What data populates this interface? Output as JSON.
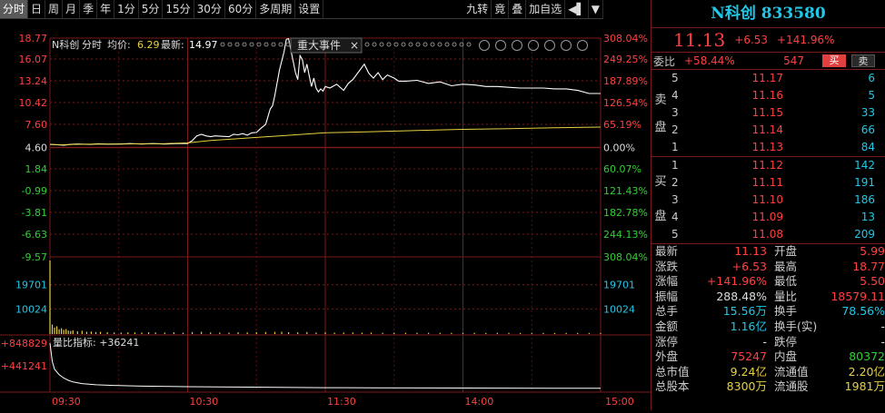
{
  "toolbar": {
    "items": [
      "分时",
      "日",
      "周",
      "月",
      "季",
      "年",
      "1分",
      "5分",
      "15分",
      "30分",
      "60分",
      "多周期",
      "设置"
    ],
    "right": [
      "九转",
      "竟",
      "叠",
      "加自选",
      "◀▌",
      "▼"
    ]
  },
  "chart_header": {
    "name": "N科创",
    "mode": "分时",
    "avg_label": "均价:",
    "avg_value": "6.29",
    "last_label": "最新:",
    "last_value": "14.97",
    "event_button": "重大事件",
    "close_symbol": "×"
  },
  "chart_data": {
    "type": "line",
    "title": "",
    "prev_close": 4.6,
    "ylim": [
      -9.57,
      18.77
    ],
    "price_ticks": [
      "18.77",
      "16.07",
      "13.24",
      "10.42",
      "7.60",
      "4.60",
      "1.84",
      "-0.99",
      "-3.81",
      "-6.63",
      "-9.57"
    ],
    "price_tick_values": [
      18.77,
      16.07,
      13.24,
      10.42,
      7.6,
      4.6,
      1.84,
      -0.99,
      -3.81,
      -6.63,
      -9.57
    ],
    "pct_ticks": [
      "308.04%",
      "249.25%",
      "187.89%",
      "126.54%",
      "65.19%",
      "0.00%",
      "60.07%",
      "121.43%",
      "182.78%",
      "244.13%",
      "308.04%"
    ],
    "volume_ticks": [
      "19701",
      "10024"
    ],
    "volume_max": 29400,
    "indicator_label": "量比指标: +36241",
    "indicator_ticks": [
      "+848829",
      "+441241"
    ],
    "time_labels": [
      "09:30",
      "10:30",
      "11:30",
      "14:00",
      "15:00"
    ],
    "price_series": [
      [
        0,
        5.0
      ],
      [
        3,
        4.95
      ],
      [
        6,
        4.9
      ],
      [
        9,
        5.0
      ],
      [
        12,
        5.05
      ],
      [
        15,
        5.02
      ],
      [
        18,
        5.0
      ],
      [
        21,
        5.08
      ],
      [
        25,
        5.03
      ],
      [
        30,
        5.05
      ],
      [
        35,
        5.1
      ],
      [
        40,
        5.05
      ],
      [
        45,
        5.1
      ],
      [
        50,
        5.05
      ],
      [
        55,
        5.1
      ],
      [
        60,
        5.12
      ],
      [
        62,
        5.5
      ],
      [
        64,
        6.1
      ],
      [
        66,
        6.3
      ],
      [
        68,
        6.1
      ],
      [
        70,
        6.0
      ],
      [
        72,
        6.1
      ],
      [
        75,
        6.05
      ],
      [
        78,
        6.0
      ],
      [
        80,
        6.3
      ],
      [
        82,
        6.25
      ],
      [
        84,
        6.4
      ],
      [
        86,
        6.2
      ],
      [
        88,
        6.5
      ],
      [
        90,
        6.55
      ],
      [
        92,
        7.1
      ],
      [
        94,
        7.6
      ],
      [
        96,
        9.6
      ],
      [
        97,
        10.0
      ],
      [
        98,
        11.3
      ],
      [
        100,
        14.6
      ],
      [
        102,
        17.0
      ],
      [
        103,
        18.6
      ],
      [
        104,
        18.7
      ],
      [
        105,
        17.2
      ],
      [
        106,
        15.8
      ],
      [
        107,
        14.3
      ],
      [
        108,
        13.4
      ],
      [
        109,
        16.5
      ],
      [
        110,
        16.0
      ],
      [
        111,
        14.3
      ],
      [
        112,
        15.4
      ],
      [
        113,
        13.9
      ],
      [
        114,
        12.5
      ],
      [
        115,
        13.6
      ],
      [
        116,
        12.3
      ],
      [
        117,
        11.8
      ],
      [
        118,
        12.2
      ],
      [
        119,
        11.9
      ],
      [
        120,
        12.5
      ],
      [
        122,
        12.3
      ],
      [
        125,
        12.8
      ],
      [
        128,
        12.0
      ],
      [
        130,
        12.9
      ],
      [
        132,
        13.4
      ],
      [
        135,
        14.6
      ],
      [
        137,
        15.4
      ],
      [
        139,
        14.2
      ],
      [
        141,
        13.6
      ],
      [
        143,
        14.3
      ],
      [
        145,
        13.4
      ],
      [
        147,
        14.0
      ],
      [
        150,
        13.6
      ],
      [
        152,
        13.2
      ],
      [
        155,
        13.2
      ],
      [
        160,
        13.3
      ],
      [
        165,
        12.9
      ],
      [
        170,
        13.1
      ],
      [
        175,
        12.6
      ],
      [
        180,
        12.8
      ],
      [
        185,
        12.7
      ],
      [
        190,
        12.5
      ],
      [
        195,
        12.5
      ],
      [
        200,
        12.4
      ],
      [
        205,
        12.3
      ],
      [
        210,
        12.3
      ],
      [
        215,
        12.3
      ],
      [
        220,
        12.2
      ],
      [
        225,
        12.2
      ],
      [
        230,
        12.0
      ],
      [
        235,
        11.6
      ],
      [
        240,
        11.6
      ]
    ],
    "avg_series": [
      [
        0,
        5.0
      ],
      [
        5,
        4.95
      ],
      [
        10,
        5.0
      ],
      [
        20,
        5.05
      ],
      [
        30,
        5.05
      ],
      [
        40,
        5.08
      ],
      [
        50,
        5.1
      ],
      [
        60,
        5.2
      ],
      [
        70,
        5.5
      ],
      [
        80,
        5.7
      ],
      [
        90,
        5.9
      ],
      [
        100,
        6.1
      ],
      [
        110,
        6.3
      ],
      [
        120,
        6.5
      ],
      [
        140,
        6.65
      ],
      [
        160,
        6.8
      ],
      [
        180,
        6.95
      ],
      [
        200,
        7.05
      ],
      [
        220,
        7.15
      ],
      [
        240,
        7.25
      ]
    ],
    "volume_series": [
      [
        0,
        29400
      ],
      [
        1,
        3800
      ],
      [
        2,
        2600
      ],
      [
        3,
        3100
      ],
      [
        4,
        1900
      ],
      [
        5,
        2300
      ],
      [
        6,
        1700
      ],
      [
        7,
        2000
      ],
      [
        8,
        1400
      ],
      [
        9,
        1200
      ],
      [
        10,
        1500
      ],
      [
        12,
        1100
      ],
      [
        14,
        1300
      ],
      [
        16,
        900
      ],
      [
        18,
        1000
      ],
      [
        20,
        800
      ],
      [
        22,
        900
      ],
      [
        25,
        700
      ],
      [
        28,
        650
      ],
      [
        31,
        600
      ],
      [
        34,
        700
      ],
      [
        37,
        650
      ],
      [
        40,
        600
      ],
      [
        43,
        700
      ],
      [
        46,
        650
      ],
      [
        50,
        600
      ],
      [
        54,
        700
      ],
      [
        58,
        550
      ],
      [
        62,
        800
      ],
      [
        66,
        900
      ],
      [
        70,
        650
      ],
      [
        74,
        600
      ],
      [
        78,
        550
      ],
      [
        82,
        700
      ],
      [
        86,
        650
      ],
      [
        90,
        750
      ],
      [
        94,
        800
      ],
      [
        98,
        850
      ],
      [
        101,
        900
      ],
      [
        104,
        750
      ],
      [
        108,
        700
      ],
      [
        112,
        800
      ],
      [
        116,
        600
      ],
      [
        120,
        650
      ],
      [
        124,
        550
      ],
      [
        128,
        600
      ],
      [
        132,
        650
      ],
      [
        136,
        550
      ],
      [
        140,
        600
      ],
      [
        145,
        500
      ],
      [
        150,
        550
      ],
      [
        155,
        500
      ],
      [
        160,
        520
      ],
      [
        165,
        480
      ],
      [
        170,
        500
      ],
      [
        175,
        480
      ],
      [
        180,
        460
      ],
      [
        185,
        500
      ],
      [
        190,
        450
      ],
      [
        195,
        480
      ],
      [
        200,
        460
      ],
      [
        205,
        440
      ],
      [
        210,
        470
      ],
      [
        215,
        450
      ],
      [
        220,
        430
      ],
      [
        225,
        460
      ],
      [
        230,
        440
      ],
      [
        235,
        420
      ],
      [
        240,
        450
      ]
    ],
    "indicator_series": [
      [
        0,
        848829
      ],
      [
        1,
        520000
      ],
      [
        2,
        380000
      ],
      [
        4,
        280000
      ],
      [
        6,
        220000
      ],
      [
        8,
        180000
      ],
      [
        10,
        150000
      ],
      [
        14,
        120000
      ],
      [
        20,
        100000
      ],
      [
        30,
        85000
      ],
      [
        40,
        75000
      ],
      [
        60,
        65000
      ],
      [
        80,
        58000
      ],
      [
        100,
        52000
      ],
      [
        120,
        48000
      ],
      [
        140,
        45000
      ],
      [
        160,
        42000
      ],
      [
        180,
        40000
      ],
      [
        200,
        38500
      ],
      [
        220,
        37000
      ],
      [
        240,
        36241
      ]
    ],
    "indicator_max": 880000,
    "grid": true
  },
  "quote": {
    "title": "N科创  833580",
    "price": "11.13",
    "change": "+6.53",
    "change_pct": "+141.96%",
    "weibi_label": "委比",
    "weibi_pct": "+58.44%",
    "weibi_diff": "547",
    "buy_btn": "买",
    "sell_btn": "卖",
    "sell_side_label": [
      "卖",
      "盘"
    ],
    "buy_side_label": [
      "买",
      "盘"
    ],
    "asks": [
      {
        "lvl": "5",
        "price": "11.17",
        "vol": "6"
      },
      {
        "lvl": "4",
        "price": "11.16",
        "vol": "5"
      },
      {
        "lvl": "3",
        "price": "11.15",
        "vol": "33"
      },
      {
        "lvl": "2",
        "price": "11.14",
        "vol": "66"
      },
      {
        "lvl": "1",
        "price": "11.13",
        "vol": "84"
      }
    ],
    "bids": [
      {
        "lvl": "1",
        "price": "11.12",
        "vol": "142"
      },
      {
        "lvl": "2",
        "price": "11.11",
        "vol": "191"
      },
      {
        "lvl": "3",
        "price": "11.10",
        "vol": "186"
      },
      {
        "lvl": "4",
        "price": "11.09",
        "vol": "13"
      },
      {
        "lvl": "5",
        "price": "11.08",
        "vol": "209"
      }
    ],
    "stats": [
      {
        "l1": "最新",
        "v1": "11.13",
        "c1": "red",
        "l2": "开盘",
        "v2": "5.99",
        "c2": "red"
      },
      {
        "l1": "涨跌",
        "v1": "+6.53",
        "c1": "red",
        "l2": "最高",
        "v2": "18.77",
        "c2": "red"
      },
      {
        "l1": "涨幅",
        "v1": "+141.96%",
        "c1": "red",
        "l2": "最低",
        "v2": "5.50",
        "c2": "red"
      },
      {
        "l1": "振幅",
        "v1": "288.48%",
        "c1": "wht",
        "l2": "量比",
        "v2": "18579.11",
        "c2": "red"
      },
      {
        "l1": "总手",
        "v1": "15.56万",
        "c1": "cyan",
        "l2": "换手",
        "v2": "78.56%",
        "c2": "cyan"
      },
      {
        "l1": "金额",
        "v1": "1.16亿",
        "c1": "cyan",
        "l2": "换手(实)",
        "v2": "-",
        "c2": "wht"
      },
      {
        "l1": "涨停",
        "v1": "-",
        "c1": "wht",
        "l2": "跌停",
        "v2": "-",
        "c2": "wht"
      },
      {
        "l1": "外盘",
        "v1": "75247",
        "c1": "red",
        "l2": "内盘",
        "v2": "80372",
        "c2": "grn"
      },
      {
        "l1": "总市值",
        "v1": "9.24亿",
        "c1": "yel",
        "l2": "流通值",
        "v2": "2.20亿",
        "c2": "yel"
      },
      {
        "l1": "总股本",
        "v1": "8300万",
        "c1": "yel",
        "l2": "流通股",
        "v2": "1981万",
        "c2": "yel"
      }
    ]
  }
}
